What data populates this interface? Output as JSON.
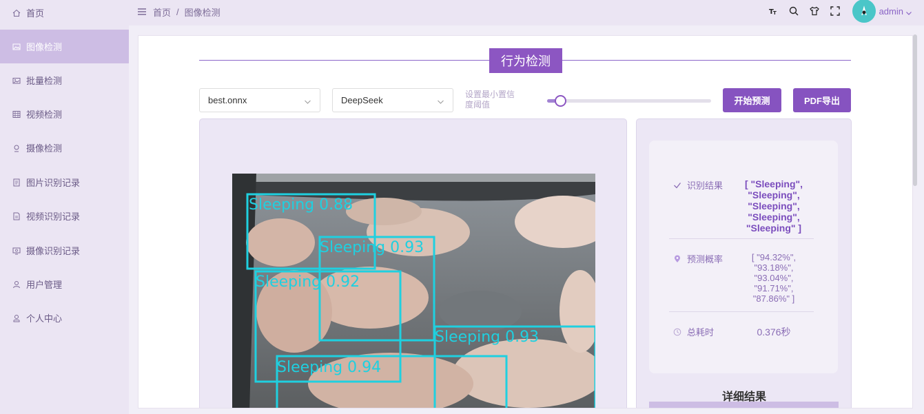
{
  "sidebar": {
    "items": [
      {
        "label": "首页",
        "icon": "home-icon"
      },
      {
        "label": "图像检测",
        "icon": "image-icon",
        "active": true
      },
      {
        "label": "批量检测",
        "icon": "images-icon"
      },
      {
        "label": "视频检测",
        "icon": "video-icon"
      },
      {
        "label": "摄像检测",
        "icon": "camera-icon"
      },
      {
        "label": "图片识别记录",
        "icon": "doc-icon"
      },
      {
        "label": "视频识别记录",
        "icon": "doc-video-icon"
      },
      {
        "label": "摄像识别记录",
        "icon": "screen-icon"
      },
      {
        "label": "用户管理",
        "icon": "user-icon"
      },
      {
        "label": "个人中心",
        "icon": "person-icon"
      }
    ]
  },
  "header": {
    "breadcrumb": [
      "首页",
      "图像检测"
    ],
    "breadcrumb_sep": "/",
    "tools": [
      "font-size-icon",
      "search-icon",
      "shirt-icon",
      "fullscreen-icon"
    ],
    "user": "admin"
  },
  "main": {
    "title": "行为检测",
    "model_select": "best.onnx",
    "ai_select": "DeepSeek",
    "threshold_label": "设置最小置信度阈值",
    "threshold_value": 0.08,
    "predict_button": "开始预测",
    "export_button": "PDF导出"
  },
  "detections": [
    {
      "label": "Sleeping 0.88"
    },
    {
      "label": "Sleeping 0.93"
    },
    {
      "label": "Sleeping 0.92"
    },
    {
      "label": "Sleeping 0.93"
    },
    {
      "label": "Sleeping 0.94"
    }
  ],
  "result": {
    "class_label": "识别结果",
    "class_values": [
      "[ \"Sleeping\",",
      "\"Sleeping\",",
      "\"Sleeping\",",
      "\"Sleeping\",",
      "\"Sleeping\" ]"
    ],
    "prob_label": "预测概率",
    "prob_values": [
      "[ \"94.32%\",",
      "\"93.18%\",",
      "\"93.04%\",",
      "\"91.71%\",",
      "\"87.86%\" ]"
    ],
    "time_label": "总耗时",
    "time_value": "0.376秒",
    "detail_title": "详细结果"
  },
  "colors": {
    "accent": "#8653c0",
    "sidebar_active": "#cdbde4",
    "box": "#1fd0e0"
  }
}
